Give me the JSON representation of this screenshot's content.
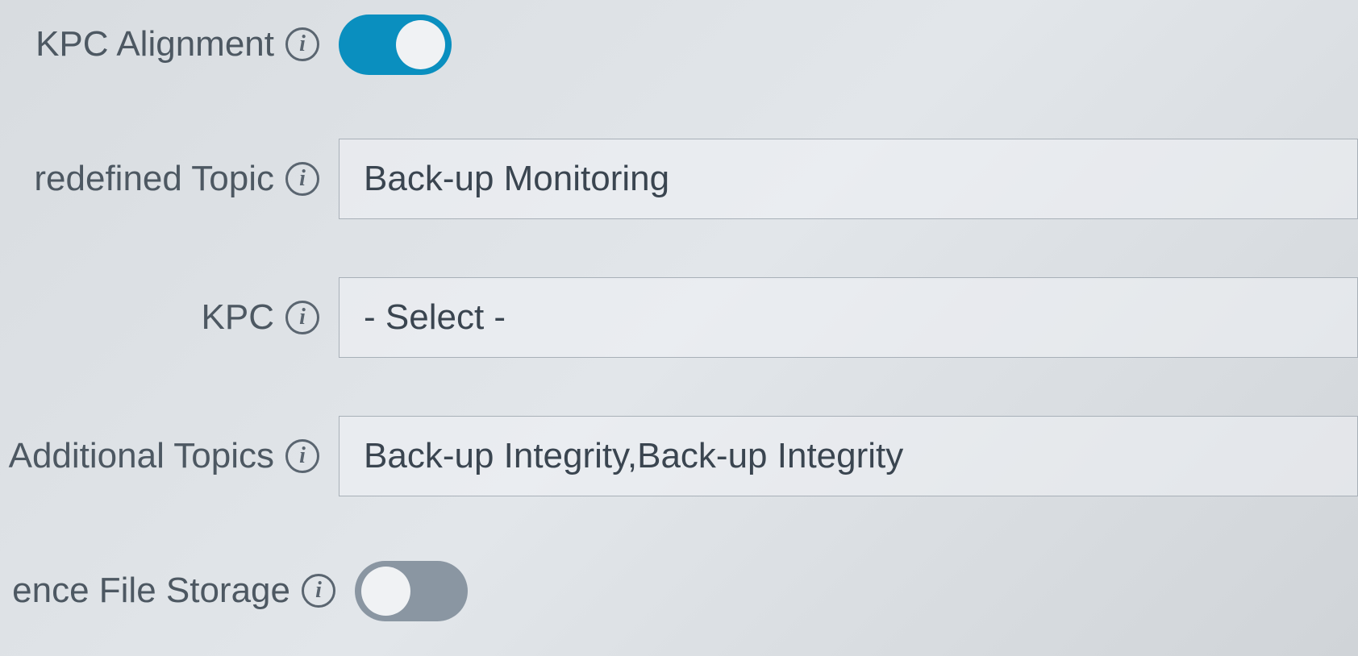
{
  "rows": {
    "kpc_alignment": {
      "label": "KPC Alignment",
      "toggle_on": true
    },
    "predefined_topic": {
      "label": "redefined Topic",
      "value": "Back-up Monitoring"
    },
    "kpc": {
      "label": "KPC",
      "value": "- Select -"
    },
    "additional_topics": {
      "label": "Additional Topics",
      "value": "Back-up Integrity,Back-up Integrity"
    },
    "file_storage": {
      "label": "ence File Storage",
      "toggle_on": false
    }
  },
  "info_glyph": "i"
}
